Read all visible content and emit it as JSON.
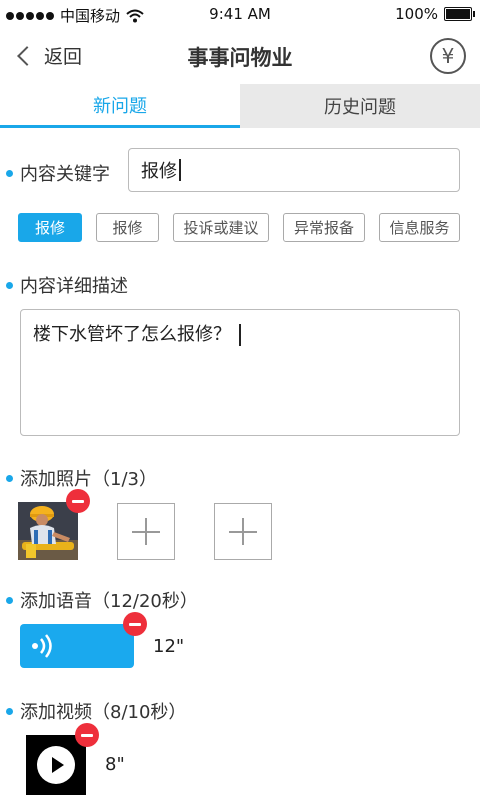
{
  "status_bar": {
    "carrier": "中国移动",
    "time": "9:41 AM",
    "battery_percent": "100%"
  },
  "nav": {
    "back_label": "返回",
    "title": "事事问物业",
    "right_icon": "yen-icon",
    "right_symbol": "¥"
  },
  "tabs": [
    {
      "label": "新问题",
      "active": true
    },
    {
      "label": "历史问题",
      "active": false
    }
  ],
  "keyword": {
    "label": "内容关键字",
    "value": "报修"
  },
  "tags": [
    {
      "label": "报修",
      "selected": true
    },
    {
      "label": "报修",
      "selected": false
    },
    {
      "label": "投诉或建议",
      "selected": false
    },
    {
      "label": "异常报备",
      "selected": false
    },
    {
      "label": "信息服务",
      "selected": false
    }
  ],
  "description": {
    "label": "内容详细描述",
    "value": "楼下水管坏了怎么报修？"
  },
  "photos": {
    "label": "添加照片（1/3）"
  },
  "voice": {
    "label": "添加语音（12/20秒）",
    "duration": "12\""
  },
  "video": {
    "label": "添加视频（8/10秒）",
    "duration": "8\""
  },
  "colors": {
    "accent": "#19a7e9",
    "remove": "#ee2f3b",
    "voice_bubble": "#1aa9ee"
  }
}
